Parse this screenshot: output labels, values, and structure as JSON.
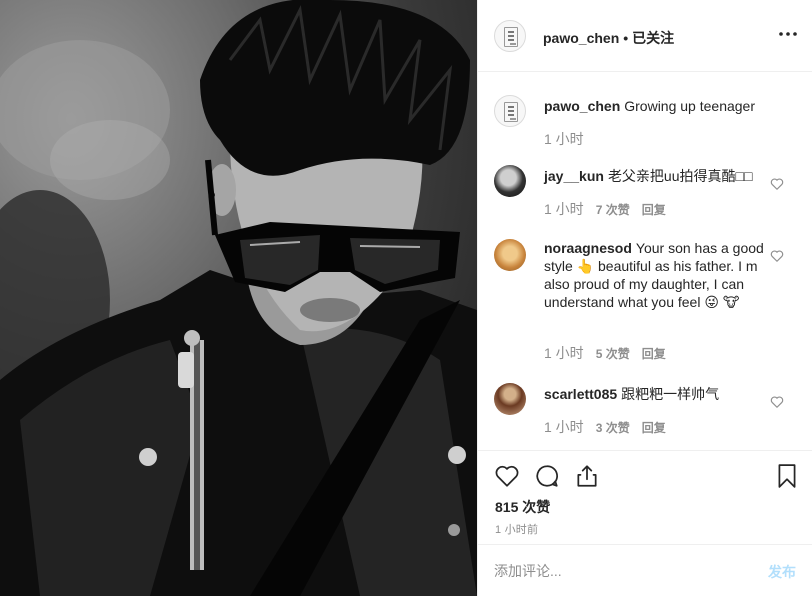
{
  "post": {
    "image_alt": "Black and white photo of a young man with spiked hair wearing sunglasses and a black leather jacket with a zipper"
  },
  "header": {
    "username": "pawo_chen",
    "separator": "•",
    "follow_status": "已关注",
    "more_icon": "ellipsis-icon"
  },
  "comments": [
    {
      "username": "pawo_chen",
      "text": "Growing up teenager",
      "time": "1 小时",
      "likes": "",
      "reply": "",
      "avatar": "brand-logo-avatar"
    },
    {
      "username": "jay__kun",
      "text": "老父亲把uu拍得真酷□□",
      "time": "1 小时",
      "likes": "7 次赞",
      "reply": "回复",
      "avatar": "user-photo-avatar"
    },
    {
      "username": "noraagnesod",
      "text": "Your son has a good style 👆 beautiful as his father. I m also proud of my daughter, I can understand what you feel 😜 🐮",
      "time": "1 小时",
      "likes": "5 次赞",
      "reply": "回复",
      "avatar": "user-photo-avatar"
    },
    {
      "username": "scarlett085",
      "text": "跟粑粑一样帅气",
      "time": "1 小时",
      "likes": "3 次赞",
      "reply": "回复",
      "avatar": "user-photo-avatar"
    }
  ],
  "actions": {
    "likes": "815 次赞",
    "posted": "1 小时前"
  },
  "composer": {
    "placeholder": "添加评论...",
    "post_label": "发布"
  },
  "colors": {
    "text": "#262626",
    "muted": "#8e8e8e",
    "border": "#efefef",
    "post_disabled": "#b2dffc"
  }
}
